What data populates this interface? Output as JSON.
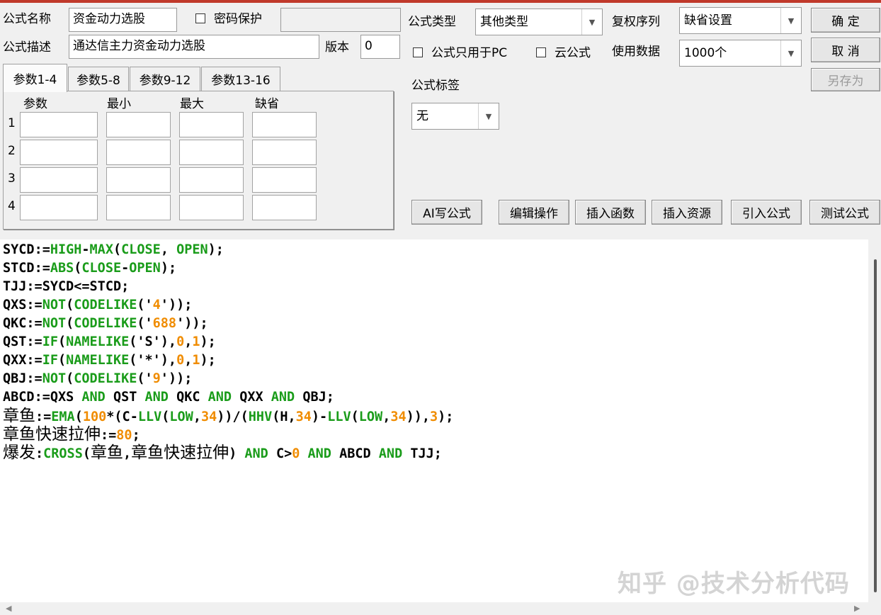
{
  "form": {
    "name_label": "公式名称",
    "name_value": "资金动力选股",
    "password_label": "密码保护",
    "password_value": "",
    "desc_label": "公式描述",
    "desc_value": "通达信主力资金动力选股",
    "version_label": "版本",
    "version_value": "0",
    "type_label": "公式类型",
    "type_value": "其他类型",
    "adjust_label": "复权序列",
    "adjust_value": "缺省设置",
    "pc_only_label": "公式只用于PC",
    "cloud_label": "云公式",
    "data_label": "使用数据",
    "data_value": "1000个",
    "tag_label": "公式标签",
    "tag_value": "无"
  },
  "buttons": {
    "ok": "确  定",
    "cancel": "取  消",
    "save_as": "另存为",
    "ai": "AI写公式",
    "edit_ops": "编辑操作",
    "insert_func": "插入函数",
    "insert_res": "插入资源",
    "import_formula": "引入公式",
    "test_formula": "测试公式"
  },
  "tabs": [
    "参数1-4",
    "参数5-8",
    "参数9-12",
    "参数13-16"
  ],
  "params": {
    "headers": [
      "参数",
      "最小",
      "最大",
      "缺省"
    ],
    "rows": [
      "1",
      "2",
      "3",
      "4"
    ]
  },
  "code_lines": [
    "SYCD:=HIGH-MAX(CLOSE, OPEN);",
    "STCD:=ABS(CLOSE-OPEN);",
    "TJJ:=SYCD<=STCD;",
    "QXS:=NOT(CODELIKE('4'));",
    "QKC:=NOT(CODELIKE('688'));",
    "QST:=IF(NAMELIKE('S'),0,1);",
    "QXX:=IF(NAMELIKE('*'),0,1);",
    "QBJ:=NOT(CODELIKE('9'));",
    "ABCD:=QXS AND QST AND QKC AND QXX AND QBJ;",
    "章鱼:=EMA(100*(C-LLV(LOW,34))/(HHV(H,34)-LLV(LOW,34)),3);",
    "章鱼快速拉伸:=80;",
    "爆发:CROSS(章鱼,章鱼快速拉伸) AND C>0 AND ABCD AND TJJ;"
  ],
  "watermark": "知乎 @技术分析代码",
  "colors": {
    "keyword": "#1a9c1a",
    "number": "#f08c00",
    "topline": "#c0392b"
  },
  "icons": [
    "dropdown-arrow-icon",
    "checkbox-icon",
    "scroll-left-icon",
    "scroll-right-icon"
  ]
}
